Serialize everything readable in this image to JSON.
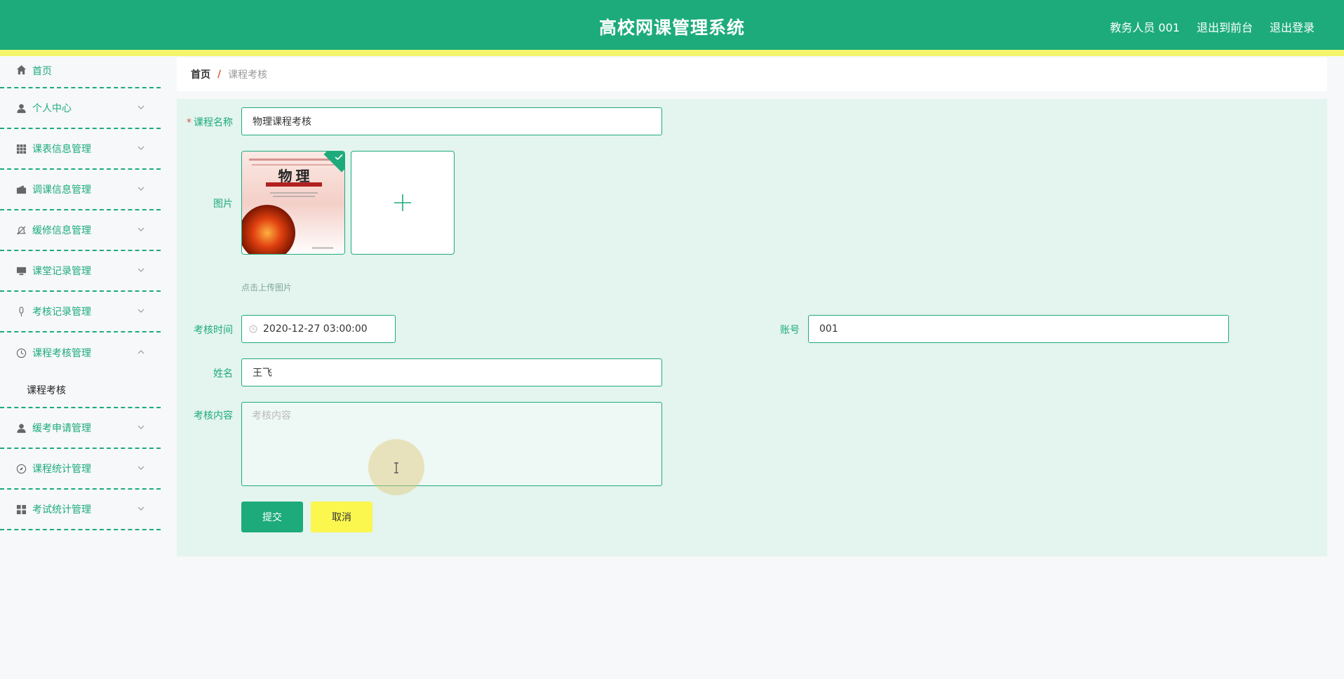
{
  "header": {
    "title": "高校网课管理系统",
    "user": "教务人员 001",
    "back_to_front": "退出到前台",
    "logout": "退出登录"
  },
  "sidebar": {
    "items": [
      {
        "label": "首页",
        "icon": "home-icon"
      },
      {
        "label": "个人中心",
        "icon": "user-icon"
      },
      {
        "label": "课表信息管理",
        "icon": "grid-icon"
      },
      {
        "label": "调课信息管理",
        "icon": "wallet-icon"
      },
      {
        "label": "缓修信息管理",
        "icon": "bell-off-icon"
      },
      {
        "label": "课堂记录管理",
        "icon": "monitor-icon"
      },
      {
        "label": "考核记录管理",
        "icon": "microphone-icon"
      },
      {
        "label": "课程考核管理",
        "icon": "clock-icon"
      },
      {
        "label": "缓考申请管理",
        "icon": "user-icon"
      },
      {
        "label": "课程统计管理",
        "icon": "compass-icon"
      },
      {
        "label": "考试统计管理",
        "icon": "dashboard-icon"
      }
    ],
    "submenu": {
      "label": "课程考核"
    }
  },
  "breadcrumb": {
    "home": "首页",
    "separator": "/",
    "current": "课程考核"
  },
  "form": {
    "course_name_label": "课程名称",
    "course_name_value": "物理课程考核",
    "image_label": "图片",
    "upload_hint": "点击上传图片",
    "thumb_title": "物 理",
    "exam_time_label": "考核时间",
    "exam_time_value": "2020-12-27 03:00:00",
    "account_label": "账号",
    "account_value": "001",
    "name_label": "姓名",
    "name_value": "王飞",
    "content_label": "考核内容",
    "content_placeholder": "考核内容",
    "submit": "提交",
    "cancel": "取消"
  },
  "colors": {
    "primary": "#1dab7c",
    "accent_yellow": "#f3f56a",
    "panel_bg": "#e4f4ee"
  }
}
